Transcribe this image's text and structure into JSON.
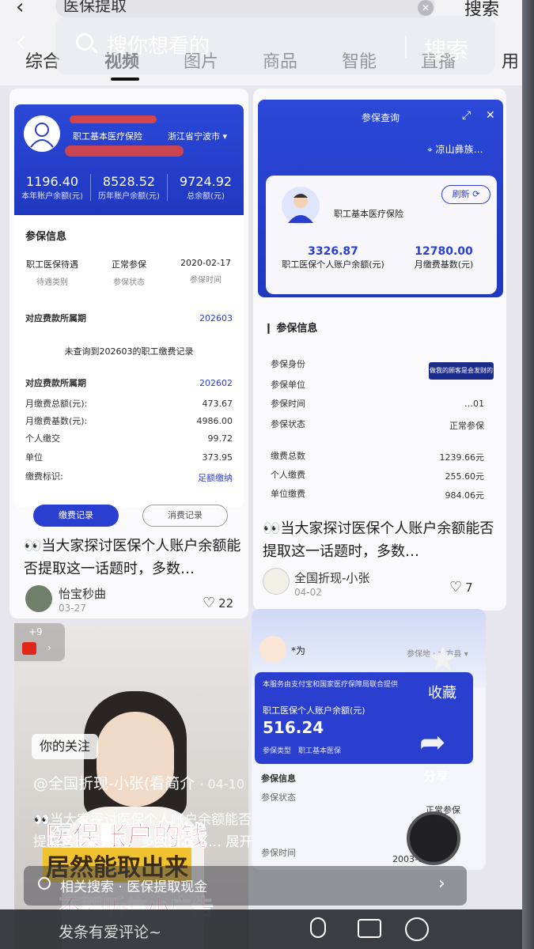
{
  "top_query": "医保提取",
  "top_search_label": "搜索",
  "search": {
    "placeholder": "搜你想看的",
    "button": "搜索"
  },
  "tabs": [
    "综合",
    "视频",
    "图片",
    "商品",
    "智能",
    "直播",
    "用"
  ],
  "card1": {
    "insurance_type": "职工基本医疗保险",
    "region": "浙江省宁波市",
    "stats": [
      {
        "value": "1196.40",
        "label": "本年账户余额(元)"
      },
      {
        "value": "8528.52",
        "label": "历年账户余额(元)"
      },
      {
        "value": "9724.92",
        "label": "总余额(元)"
      }
    ],
    "section_title": "参保信息",
    "info": [
      {
        "value": "职工医保待遇",
        "label": "待遇类别"
      },
      {
        "value": "正常参保",
        "label": "参保状态"
      },
      {
        "value": "2020-02-17",
        "label": "参保时间"
      }
    ],
    "period_label": "对应费款所属期",
    "period_value_1": "202603",
    "no_record": "未查询到202603的职工缴费记录",
    "period_value_2": "202602",
    "rows": [
      {
        "label": "月缴费总额(元):",
        "value": "473.67"
      },
      {
        "label": "月缴费基数(元):",
        "value": "4986.00"
      },
      {
        "label": "个人缴交",
        "value": "99.72"
      },
      {
        "label": "单位",
        "value": "373.95"
      },
      {
        "label": "缴费标识:",
        "value": "足额缴纳"
      }
    ],
    "btn_records": "缴费记录",
    "btn_consume": "消费记录",
    "title": "👀当大家探讨医保个人账户余额能否提取这一话题时，多数…",
    "author": "怡宝秒曲",
    "date": "03-27",
    "likes": "22"
  },
  "card2": {
    "header": "参保查询",
    "location": "凉山彝族…",
    "insurance_type": "职工基本医疗保险",
    "refresh": "刷新",
    "stats": [
      {
        "value": "3326.87",
        "label": "职工医保个人账户余额(元)"
      },
      {
        "value": "12780.00",
        "label": "月缴费基数(元)"
      }
    ],
    "section_title": "参保信息",
    "rows": [
      {
        "label": "参保身份",
        "value": ""
      },
      {
        "label": "参保单位",
        "value": ""
      },
      {
        "label": "参保时间",
        "value": "…01"
      },
      {
        "label": "参保状态",
        "value": "正常参保"
      },
      {
        "label": "缴费总数",
        "value": "1239.66元"
      },
      {
        "label": "个人缴费",
        "value": "255.60元"
      },
      {
        "label": "单位缴费",
        "value": "984.06元"
      }
    ],
    "sign_text": "做我的顾客是会发财的",
    "title": "👀当大家探讨医保个人账户余额能否提取这一话题时，多数…",
    "author": "全国折现-小张",
    "date": "04-02",
    "likes": "7"
  },
  "card3": {
    "name": "*为",
    "dropdown": "参保地 · 大方县",
    "banner": "本服务由支付宝和国家医疗保障局联合提供",
    "account_label": "职工医保个人账户余额(元)",
    "amount": "516.24",
    "insurance_type_label": "参保类型",
    "insurance_type": "职工基本医保",
    "section_title": "参保信息",
    "status_label": "参保状态",
    "status": "正常参保",
    "date_label": "参保时间",
    "date": "2003-01-01"
  },
  "video": {
    "follow_badge": "你的关注",
    "author_line": "@全国折现-小张(看简介",
    "date": "· 04-10",
    "caption_1": "👀当大家探讨医保个人账户余额能否",
    "caption_2": "提取这一话题时，多数情况下… 展开",
    "overlay_1": "医保账户的钱",
    "overlay_2": "居然能取出来",
    "overlay_3": "不要听信小广告",
    "gift_count": "+9"
  },
  "side": {
    "favorite": "收藏",
    "share": "分享"
  },
  "related": {
    "label": "相关搜索 · 医保提取现金"
  },
  "comment": {
    "placeholder": "发条有爱评论~"
  },
  "colors": {
    "brand_blue": "#2a3fd0",
    "card_bg": "#fafafc"
  }
}
